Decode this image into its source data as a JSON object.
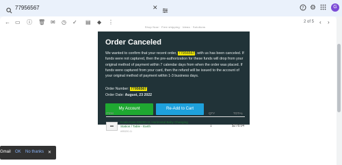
{
  "search": {
    "query": "77956567"
  },
  "pager": "2 of 5",
  "crumbs": "Shop Now  ·  Free shipping  ·  Ideas  ·  Solutions",
  "email": {
    "title": "Order Canceled",
    "p1_pre": "We wanted to confirm that your recent order,",
    "order_id": "77956567",
    "p1_post": ", with us has been canceled. If funds were not captured, then the pre-authorization for these funds will drop from your original method of payment within 7 calendar days from when the order was placed. If funds were captured from your card, then the refund will be issued to the account of your original method of payment within 1-3 business days.",
    "order_number_label": "Order Number:",
    "order_date_label": "Order Date:",
    "order_date": "August, 23 2022",
    "btn_account": "My Account",
    "btn_cart": "Re-Add to Cart"
  },
  "table": {
    "headers": {
      "item": "ITEM",
      "qty": "QTY",
      "total": "TOTAL"
    },
    "row": {
      "name": "Koala Kare KB200-11 Horizontal Baby Changing Station / Table - Earth",
      "sku": "#KB200-11",
      "qty": "1",
      "total": "$278.04"
    }
  },
  "toast": {
    "prefix": "Gmail",
    "ok": "OK",
    "no": "No thanks",
    "close": "✕"
  },
  "colors": {
    "email_bg": "#213338",
    "account_btn": "#1fa831",
    "cart_btn": "#1ea1dc",
    "highlight": "#f2e600"
  }
}
